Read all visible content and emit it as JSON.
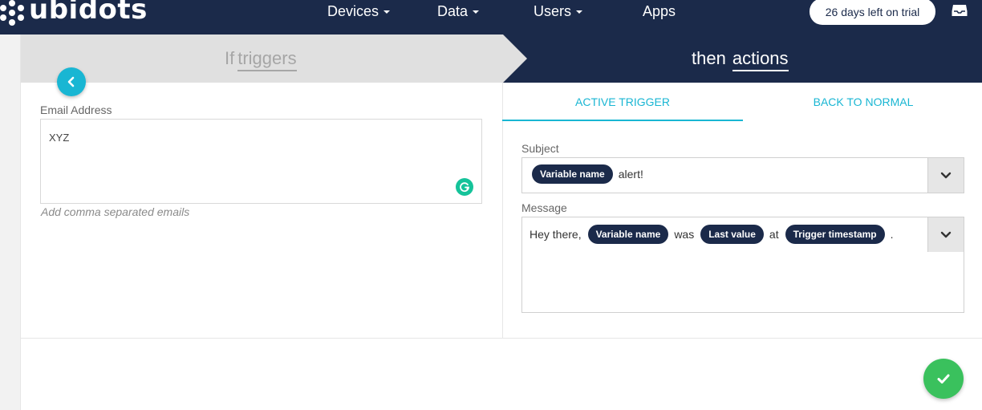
{
  "brand": {
    "name": "ubidots"
  },
  "nav": {
    "items": [
      {
        "label": "Devices",
        "dropdown": true
      },
      {
        "label": "Data",
        "dropdown": true
      },
      {
        "label": "Users",
        "dropdown": true
      },
      {
        "label": "Apps",
        "dropdown": false
      }
    ],
    "trial": "26 days left on trial"
  },
  "steps": {
    "left_prefix": "If",
    "left_word": "triggers",
    "right_prefix": "then",
    "right_word": "actions"
  },
  "email": {
    "label": "Email Address",
    "value": "XYZ",
    "hint": "Add comma separated emails"
  },
  "tabs": [
    {
      "label": "ACTIVE TRIGGER",
      "active": true
    },
    {
      "label": "BACK TO NORMAL",
      "active": false
    }
  ],
  "subject": {
    "label": "Subject",
    "chip": "Variable name",
    "text": "alert!"
  },
  "message": {
    "label": "Message",
    "parts": [
      "Hey there,",
      "Variable name",
      "was",
      "Last value",
      "at",
      "Trigger timestamp",
      "."
    ]
  },
  "colors": {
    "navy": "#1b2a4a",
    "accent": "#19b6d3",
    "success": "#3ac15d",
    "grammarly": "#15c39a"
  },
  "icons": [
    "inbox-icon",
    "chevron-left-icon",
    "grammarly-icon",
    "chevron-down-icon",
    "check-icon"
  ]
}
